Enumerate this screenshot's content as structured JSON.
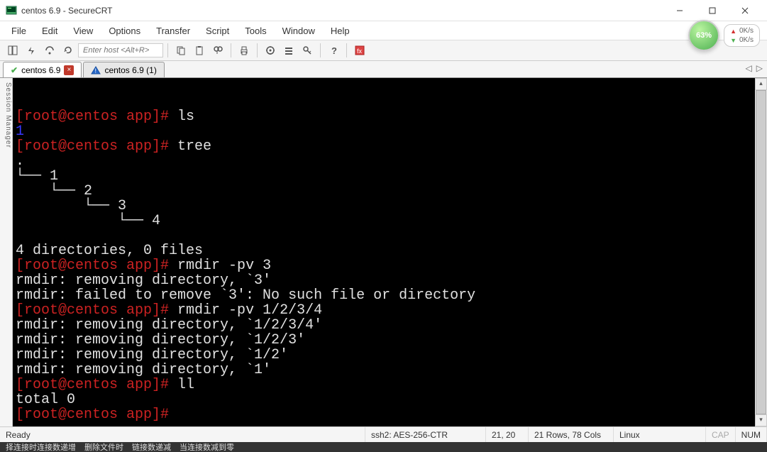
{
  "window": {
    "title": "centos 6.9 - SecureCRT"
  },
  "menu": [
    "File",
    "Edit",
    "View",
    "Options",
    "Transfer",
    "Script",
    "Tools",
    "Window",
    "Help"
  ],
  "speed": {
    "percent": "63%",
    "up": "0K/s",
    "down": "0K/s"
  },
  "host_placeholder": "Enter host <Alt+R>",
  "tabs": [
    {
      "label": "centos 6.9",
      "status": "ok",
      "closable": true
    },
    {
      "label": "centos 6.9 (1)",
      "status": "warn",
      "closable": false
    }
  ],
  "sidebar_label": "Session Manager",
  "terminal": {
    "lines": [
      {
        "t": "prompt",
        "text": "[root@centos app]# ",
        "cmd": "ls"
      },
      {
        "t": "blue",
        "text": "1"
      },
      {
        "t": "prompt",
        "text": "[root@centos app]# ",
        "cmd": "tree"
      },
      {
        "t": "white",
        "text": "."
      },
      {
        "t": "white",
        "text": "└── 1"
      },
      {
        "t": "white",
        "text": "    └── 2"
      },
      {
        "t": "white",
        "text": "        └── 3"
      },
      {
        "t": "white",
        "text": "            └── 4"
      },
      {
        "t": "white",
        "text": ""
      },
      {
        "t": "white",
        "text": "4 directories, 0 files"
      },
      {
        "t": "prompt",
        "text": "[root@centos app]# ",
        "cmd": "rmdir -pv 3"
      },
      {
        "t": "white",
        "text": "rmdir: removing directory, `3'"
      },
      {
        "t": "white",
        "text": "rmdir: failed to remove `3': No such file or directory"
      },
      {
        "t": "prompt",
        "text": "[root@centos app]# ",
        "cmd": "rmdir -pv 1/2/3/4"
      },
      {
        "t": "white",
        "text": "rmdir: removing directory, `1/2/3/4'"
      },
      {
        "t": "white",
        "text": "rmdir: removing directory, `1/2/3'"
      },
      {
        "t": "white",
        "text": "rmdir: removing directory, `1/2'"
      },
      {
        "t": "white",
        "text": "rmdir: removing directory, `1'"
      },
      {
        "t": "prompt",
        "text": "[root@centos app]# ",
        "cmd": "ll"
      },
      {
        "t": "white",
        "text": "total 0"
      },
      {
        "t": "prompt",
        "text": "[root@centos app]# ",
        "cmd": ""
      }
    ]
  },
  "status": {
    "ready": "Ready",
    "proto": "ssh2: AES-256-CTR",
    "cursor": "21, 20",
    "size": "21 Rows, 78 Cols",
    "os": "Linux",
    "cap": "CAP",
    "num": "NUM"
  },
  "bottom": [
    "择连接时连接数递增",
    "删除文件时",
    "链接数递减",
    "当连接数减到零"
  ]
}
